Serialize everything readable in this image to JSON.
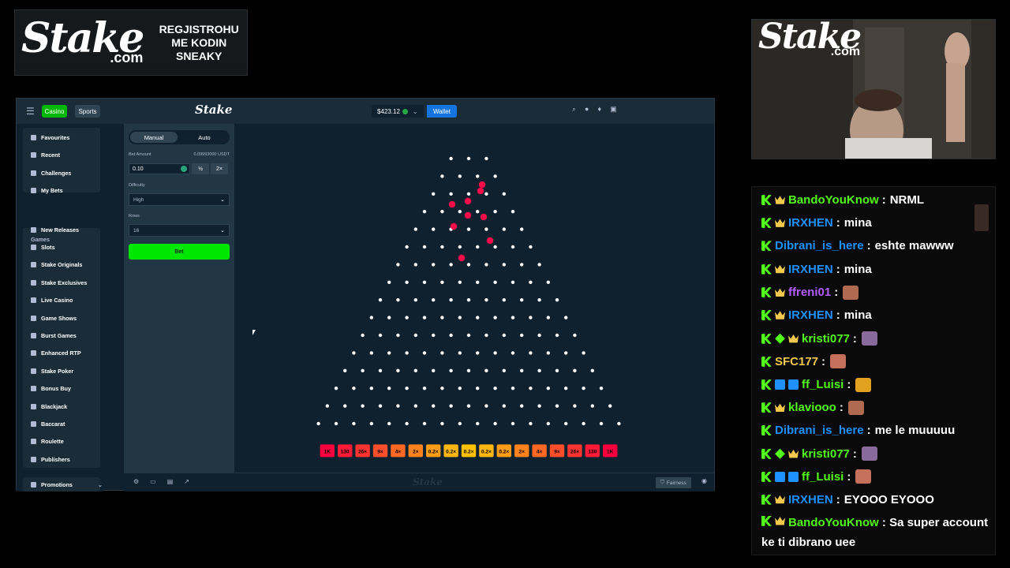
{
  "promo": {
    "logo_main": "Stake",
    "logo_sub": ".com",
    "text": "REGJISTROHU ME KODIN SNEAKY"
  },
  "topbar": {
    "casino": "Casino",
    "sports": "Sports",
    "logo": "Stake",
    "balance": "$423.12",
    "wallet": "Wallet"
  },
  "sidebar": {
    "top_items": [
      "Favourites",
      "Recent",
      "Challenges",
      "My Bets"
    ],
    "games_heading": "Games",
    "game_items": [
      "New Releases",
      "Slots",
      "Stake Originals",
      "Stake Exclusives",
      "Live Casino",
      "Game Shows",
      "Burst Games",
      "Enhanced RTP",
      "Stake Poker",
      "Bonus Buy",
      "Blackjack",
      "Baccarat",
      "Roulette",
      "Publishers"
    ],
    "promotions": "Promotions"
  },
  "panel": {
    "manual": "Manual",
    "auto": "Auto",
    "bet_amount_label": "Bet Amount",
    "bet_amount_sub": "0.09993000 USDT",
    "bet_amount_value": "0.10",
    "half": "½",
    "double": "2×",
    "difficulty_label": "Difficulty",
    "difficulty_value": "High",
    "rows_label": "Rows",
    "rows_value": "16",
    "bet_button": "Bet"
  },
  "board": {
    "rows": 16,
    "multipliers": [
      "1K",
      "130",
      "26×",
      "9×",
      "4×",
      "2×",
      "0.2×",
      "0.2×",
      "0.2×",
      "0.2×",
      "0.2×",
      "2×",
      "4×",
      "9×",
      "26×",
      "130",
      "1K"
    ],
    "multiplier_colors": [
      "#ff003f",
      "#ff1a38",
      "#ff3431",
      "#ff4e2a",
      "#ff6823",
      "#ff821c",
      "#ff9c15",
      "#ffb60e",
      "#ffc000",
      "#ffb60e",
      "#ff9c15",
      "#ff821c",
      "#ff6823",
      "#ff4e2a",
      "#ff3431",
      "#ff1a38",
      "#ff003f"
    ]
  },
  "footer": {
    "logo": "Stake",
    "fairness": "Fairness"
  },
  "webcam": {
    "logo_main": "Stake",
    "logo_sub": ".com"
  },
  "chat": {
    "messages": [
      {
        "badges": [
          "k",
          "crown"
        ],
        "name": "BandoYouKnow",
        "color": "#53fc18",
        "text": "NRML"
      },
      {
        "badges": [
          "k",
          "crown"
        ],
        "name": "IRXHEN",
        "color": "#1e90ff",
        "text": "mina"
      },
      {
        "badges": [
          "k"
        ],
        "name": "Dibrani_is_here",
        "color": "#1e90ff",
        "text": "eshte mawww"
      },
      {
        "badges": [
          "k",
          "crown"
        ],
        "name": "IRXHEN",
        "color": "#1e90ff",
        "text": "mina"
      },
      {
        "badges": [
          "k",
          "crown"
        ],
        "name": "ffreni01",
        "color": "#b45cff",
        "text": "",
        "emote": true
      },
      {
        "badges": [
          "k",
          "crown"
        ],
        "name": "IRXHEN",
        "color": "#1e90ff",
        "text": "mina"
      },
      {
        "badges": [
          "k",
          "gem",
          "crown"
        ],
        "name": "kristi077",
        "color": "#53fc18",
        "text": "",
        "emote": true
      },
      {
        "badges": [
          "k"
        ],
        "name": "SFC177",
        "color": "#f2c94c",
        "text": "",
        "emote": true
      },
      {
        "badges": [
          "k",
          "box",
          "box"
        ],
        "name": "ff_Luisi",
        "color": "#53fc18",
        "text": "",
        "emote": true
      },
      {
        "badges": [
          "k",
          "crown"
        ],
        "name": "klaviooo",
        "color": "#53fc18",
        "text": "",
        "emote": true
      },
      {
        "badges": [
          "k"
        ],
        "name": "Dibrani_is_here",
        "color": "#1e90ff",
        "text": "me le muuuuu"
      },
      {
        "badges": [
          "k",
          "gem",
          "crown"
        ],
        "name": "kristi077",
        "color": "#53fc18",
        "text": "",
        "emote": true
      },
      {
        "badges": [
          "k",
          "box",
          "box"
        ],
        "name": "ff_Luisi",
        "color": "#53fc18",
        "text": "",
        "emote": true
      },
      {
        "badges": [
          "k",
          "crown"
        ],
        "name": "IRXHEN",
        "color": "#1e90ff",
        "text": "EYOOO EYOOO"
      }
    ],
    "last": {
      "name": "BandoYouKnow",
      "color": "#53fc18",
      "text": "Sa super account ke ti dibrano uee"
    }
  }
}
